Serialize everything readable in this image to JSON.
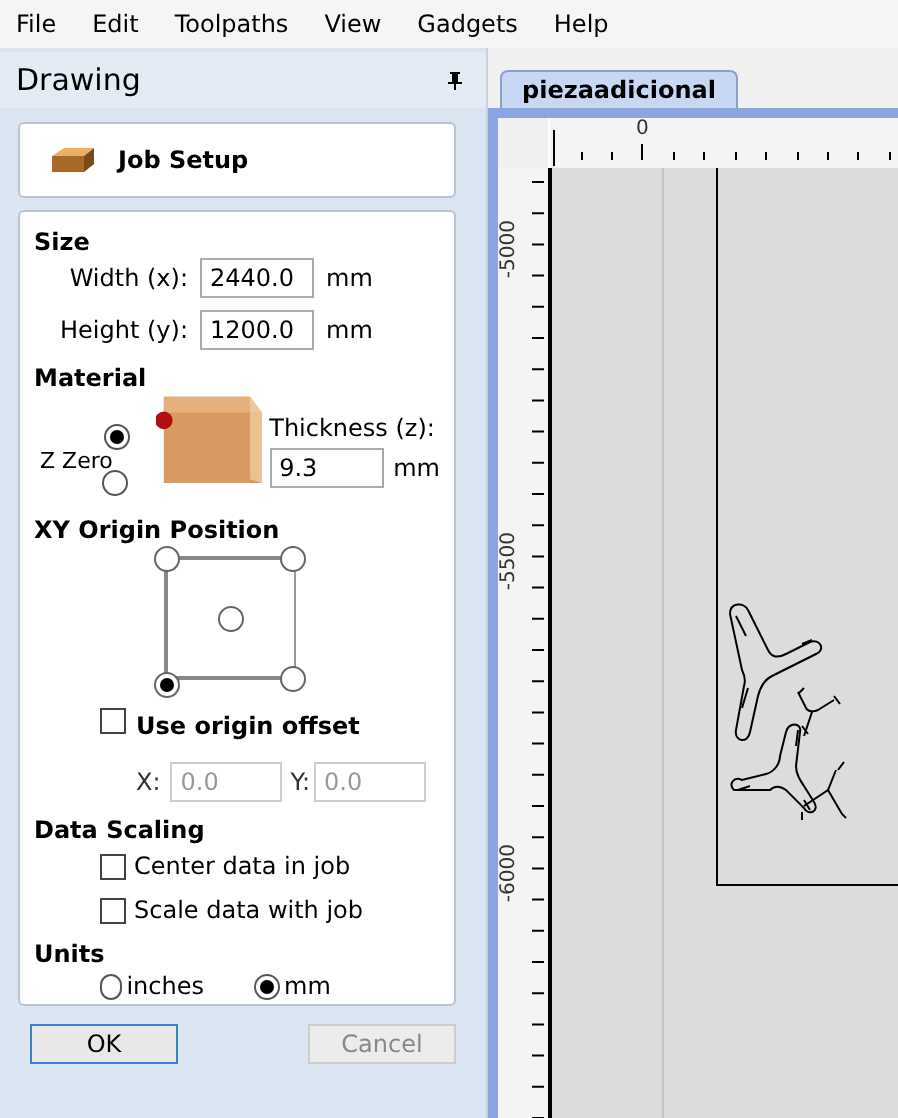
{
  "menu": [
    {
      "label": "File"
    },
    {
      "label": "Edit"
    },
    {
      "label": "Toolpaths"
    },
    {
      "label": "View"
    },
    {
      "label": "Gadgets"
    },
    {
      "label": "Help"
    }
  ],
  "panel": {
    "title": "Drawing",
    "job_setup": "Job Setup"
  },
  "size": {
    "heading": "Size",
    "fields": [
      {
        "label": "Width (x):",
        "value": "2440.0",
        "unit": "mm"
      },
      {
        "label": "Height (y):",
        "value": "1200.0",
        "unit": "mm"
      }
    ]
  },
  "material": {
    "heading": "Material",
    "z_zero_label": "Z Zero",
    "z_zero": [
      {
        "selected": true
      },
      {
        "selected": false
      }
    ],
    "thickness_label": "Thickness (z):",
    "thickness": "9.3",
    "unit": "mm"
  },
  "xy_origin": {
    "heading": "XY Origin Position",
    "points": [
      {
        "selected": false
      },
      {
        "selected": false
      },
      {
        "selected": false
      },
      {
        "selected": true
      },
      {
        "selected": false
      }
    ],
    "use_offset": {
      "label": "Use origin offset",
      "checked": false
    },
    "x_label": "X:",
    "x_value": "0.0",
    "y_label": "Y:",
    "y_value": "0.0"
  },
  "data_scaling": {
    "heading": "Data Scaling",
    "options": [
      {
        "label": "Center data in job",
        "checked": false
      },
      {
        "label": "Scale data with job",
        "checked": false
      }
    ]
  },
  "units": {
    "heading": "Units",
    "options": [
      {
        "label": "inches",
        "selected": false
      },
      {
        "label": "mm",
        "selected": true
      }
    ]
  },
  "buttons": [
    {
      "label": "OK",
      "disabled": false
    },
    {
      "label": "Cancel",
      "disabled": true
    }
  ],
  "document_tab": {
    "label": "piezaadicional",
    "selected": true
  },
  "rulers": {
    "top_labels": [
      "0"
    ],
    "left_labels": [
      "-5000",
      "-5500",
      "-6000"
    ]
  }
}
